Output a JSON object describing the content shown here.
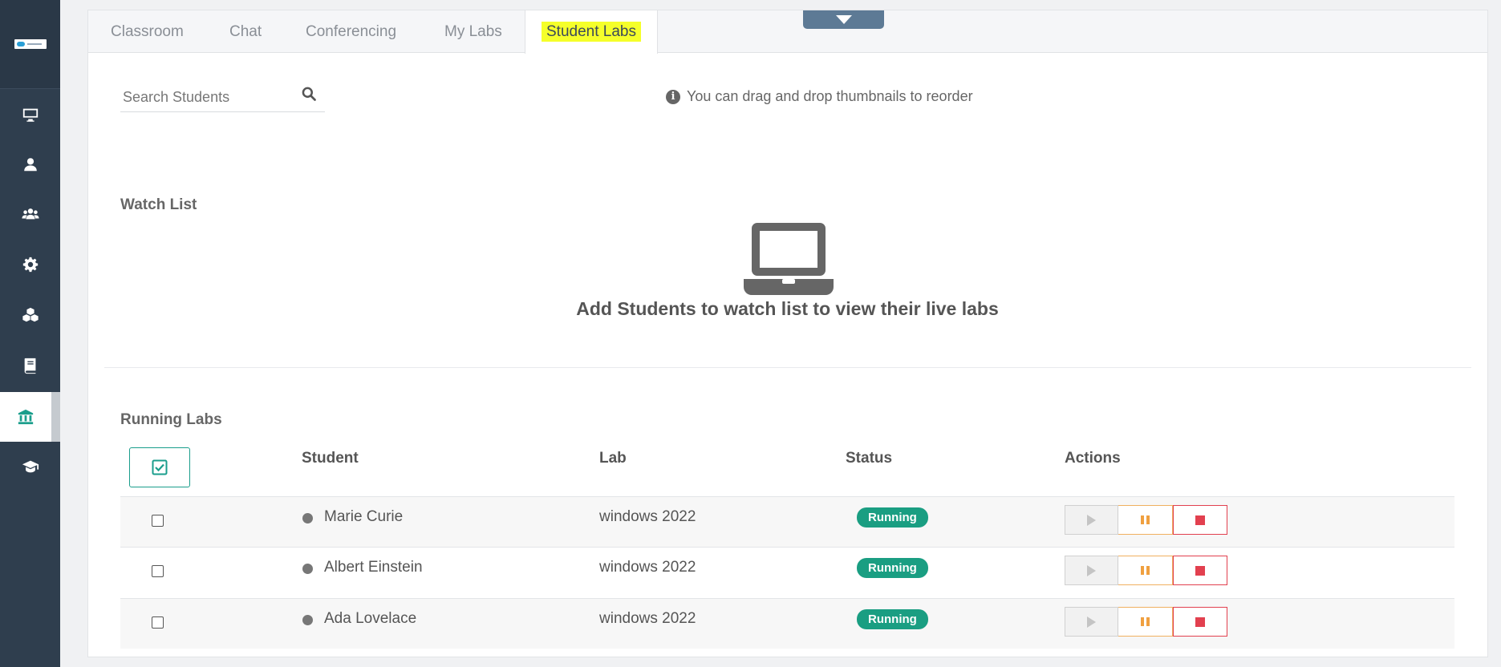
{
  "tabs": [
    {
      "label": "Classroom"
    },
    {
      "label": "Chat"
    },
    {
      "label": "Conferencing"
    },
    {
      "label": "My Labs"
    },
    {
      "label": "Student Labs"
    }
  ],
  "active_tab": "Student Labs",
  "search": {
    "placeholder": "Search Students",
    "value": ""
  },
  "hint": "You can drag and drop thumbnails to reorder",
  "watch_list": {
    "title": "Watch List",
    "empty_message": "Add Students to watch list to view their live labs"
  },
  "running_labs": {
    "title": "Running Labs",
    "columns": {
      "student": "Student",
      "lab": "Lab",
      "status": "Status",
      "actions": "Actions"
    },
    "rows": [
      {
        "student": "Marie Curie",
        "lab": "windows 2022",
        "status": "Running"
      },
      {
        "student": "Albert Einstein",
        "lab": "windows 2022",
        "status": "Running"
      },
      {
        "student": "Ada Lovelace",
        "lab": "windows 2022",
        "status": "Running"
      }
    ]
  },
  "sidebar": {
    "items": [
      {
        "icon": "monitor-icon"
      },
      {
        "icon": "user-icon"
      },
      {
        "icon": "users-icon"
      },
      {
        "icon": "gear-icon"
      },
      {
        "icon": "cubes-icon"
      },
      {
        "icon": "book-icon"
      },
      {
        "icon": "institution-icon",
        "active": true
      },
      {
        "icon": "graduation-cap-icon"
      }
    ]
  },
  "colors": {
    "sidebar_bg": "#2f3e4e",
    "accent": "#1a9e8c",
    "status_running": "#1a9e82",
    "tab_highlight": "#f5ff2a",
    "stop": "#e2404f",
    "pause": "#f0a040"
  }
}
